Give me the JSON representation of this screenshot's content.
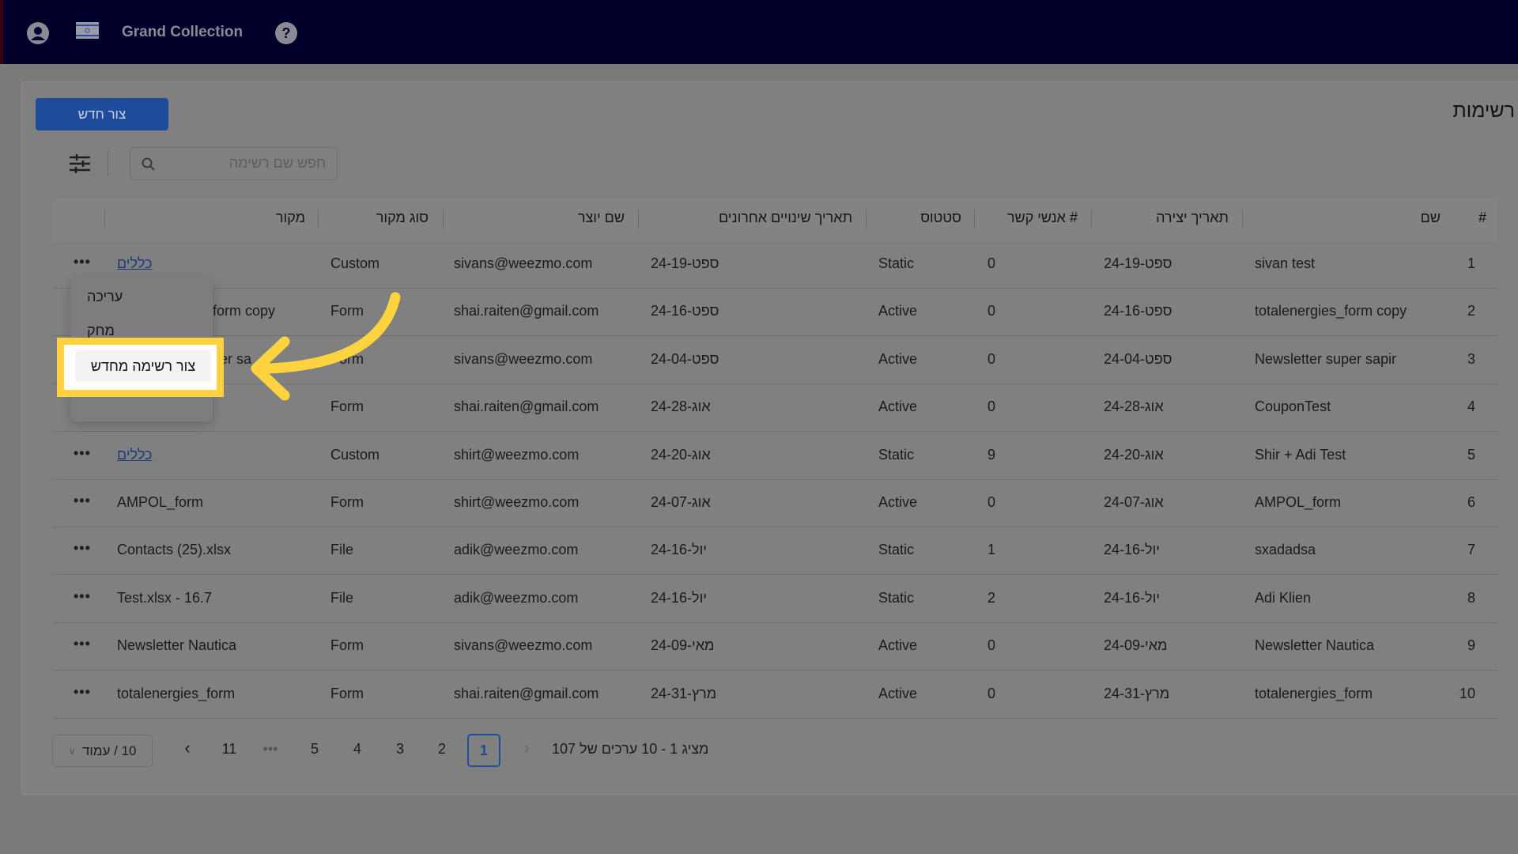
{
  "topbar": {
    "org_name": "Grand Collection",
    "icons": [
      "user-icon",
      "israel-flag-icon",
      "help-icon"
    ]
  },
  "page": {
    "title": "רשימות",
    "create_button": "צור חדש",
    "search_placeholder": "חפש שם רשימה"
  },
  "table": {
    "headers": [
      "#",
      "שם",
      "תאריך יצירה",
      "# אנשי קשר",
      "סטטוס",
      "תאריך שינויים אחרונים",
      "שם יוצר",
      "סוג מקור",
      "מקור"
    ],
    "rows": [
      {
        "n": "1",
        "name": "sivan test",
        "created": "24-ספט-19",
        "contacts": "0",
        "status": "Static",
        "modified": "24-ספט-19",
        "creator": "sivans@weezmo.com",
        "source_type": "Custom",
        "source": "כללים",
        "link": true
      },
      {
        "n": "2",
        "name": "totalenergies_form copy",
        "created": "24-ספט-16",
        "contacts": "0",
        "status": "Active",
        "modified": "24-ספט-16",
        "creator": "shai.raiten@gmail.com",
        "source_type": "Form",
        "source": "form copy",
        "link": false
      },
      {
        "n": "3",
        "name": "Newsletter super sapir",
        "created": "24-ספט-04",
        "contacts": "0",
        "status": "Active",
        "modified": "24-ספט-04",
        "creator": "sivans@weezmo.com",
        "source_type": "Form",
        "source": "er sa",
        "link": false
      },
      {
        "n": "4",
        "name": "CouponTest",
        "created": "24-אוג-28",
        "contacts": "0",
        "status": "Active",
        "modified": "24-אוג-28",
        "creator": "shai.raiten@gmail.com",
        "source_type": "Form",
        "source": "",
        "link": false
      },
      {
        "n": "5",
        "name": "Shir + Adi Test",
        "created": "24-אוג-20",
        "contacts": "9",
        "status": "Static",
        "modified": "24-אוג-20",
        "creator": "shirt@weezmo.com",
        "source_type": "Custom",
        "source": "כללים",
        "link": true
      },
      {
        "n": "6",
        "name": "AMPOL_form",
        "created": "24-אוג-07",
        "contacts": "0",
        "status": "Active",
        "modified": "24-אוג-07",
        "creator": "shirt@weezmo.com",
        "source_type": "Form",
        "source": "AMPOL_form",
        "link": false
      },
      {
        "n": "7",
        "name": "sxadadsa",
        "created": "24-יול-16",
        "contacts": "1",
        "status": "Static",
        "modified": "24-יול-16",
        "creator": "adik@weezmo.com",
        "source_type": "File",
        "source": "Contacts (25).xlsx",
        "link": false
      },
      {
        "n": "8",
        "name": "Adi Klien",
        "created": "24-יול-16",
        "contacts": "2",
        "status": "Static",
        "modified": "24-יול-16",
        "creator": "adik@weezmo.com",
        "source_type": "File",
        "source": "Test.xlsx - 16.7",
        "link": false
      },
      {
        "n": "9",
        "name": "Newsletter Nautica",
        "created": "24-מאי-09",
        "contacts": "0",
        "status": "Active",
        "modified": "24-מאי-09",
        "creator": "sivans@weezmo.com",
        "source_type": "Form",
        "source": "Newsletter Nautica",
        "link": false
      },
      {
        "n": "10",
        "name": "totalenergies_form",
        "created": "24-מרץ-31",
        "contacts": "0",
        "status": "Active",
        "modified": "24-מרץ-31",
        "creator": "shai.raiten@gmail.com",
        "source_type": "Form",
        "source": "totalenergies_form",
        "link": false
      }
    ],
    "row_menu_label": "•••"
  },
  "context_menu": {
    "items": [
      "עריכה",
      "מחק",
      "צור רשימה מחדש"
    ],
    "highlighted": "צור רשימה מחדש"
  },
  "pagination": {
    "summary": "מציג 1 - 10 ערכים של 107",
    "pages": [
      "1",
      "2",
      "3",
      "4",
      "5",
      "•••",
      "11"
    ],
    "current": "1",
    "page_size": "10 / עמוד"
  },
  "colors": {
    "topbar": "#00002a",
    "primary": "#1f4c9a",
    "highlight": "#ffd23f",
    "overlay": "#808080"
  }
}
